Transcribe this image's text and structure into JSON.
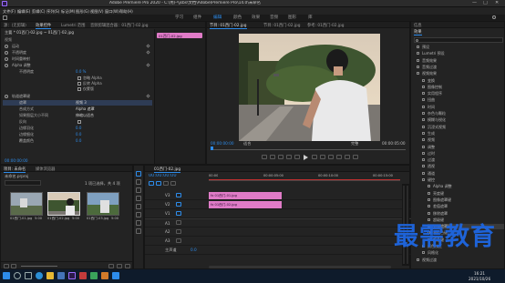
{
  "title_bar": {
    "text": "Adobe Premiere Pro 2020 - C:\\用户\\jsbs\\文档\\Adobe\\Premiere Pro\\14.0\\未命名",
    "minimize": "—",
    "maximize": "□",
    "close": "✕"
  },
  "menu": [
    "文件(F)",
    "编辑(E)",
    "剪辑(C)",
    "序列(S)",
    "标记(M)",
    "图形(G)",
    "视图(V)",
    "窗口(W)",
    "帮助(H)"
  ],
  "workspaces": [
    "学习",
    "组件",
    "编辑",
    "颜色",
    "效果",
    "音频",
    "图形",
    "库"
  ],
  "active_workspace": "编辑",
  "effect_controls": {
    "tabs": [
      "源：(无剪辑)",
      "效果控件",
      "Lumetri 范围",
      "音频剪辑混合器：01西门-02.jpg"
    ],
    "active_tab": "效果控件",
    "header": "主要 * 01西门-02.jpg ~ 01西门-02.jpg",
    "clip_bar": "01西门-02.jpg",
    "sections": [
      {
        "name": "视频",
        "rows": []
      },
      {
        "name": "运动",
        "rows": []
      },
      {
        "name": "不透明度",
        "rows": []
      },
      {
        "name": "时间重映射",
        "rows": []
      },
      {
        "name": "Alpha 调整",
        "rows": [
          {
            "label": "不透明度",
            "value": "0.0 %"
          },
          {
            "label": "忽略 Alpha",
            "value": ""
          },
          {
            "label": "反转 Alpha",
            "value": ""
          },
          {
            "label": "仅蒙版",
            "value": ""
          }
        ]
      },
      {
        "name": "轨道遮罩键",
        "rows": [
          {
            "label": "遮罩",
            "value": "视频 3"
          },
          {
            "label": "合成方式",
            "value": "Alpha 遮罩"
          },
          {
            "label": "如果图层大小不同",
            "value": "伸缩以适合"
          },
          {
            "label": "反向",
            "value": ""
          },
          {
            "label": "边缘羽化",
            "value": "0.0"
          },
          {
            "label": "边缘细化",
            "value": "0.0"
          },
          {
            "label": "覆盖颜色",
            "value": "0.0"
          }
        ]
      }
    ],
    "timecode": "00:00:00:00"
  },
  "program_monitor": {
    "title": "节目: 01西门-02.jpg",
    "tabs": [
      "节目: 01西门-02.jpg",
      "节目: 01西门-02.jpg",
      "参考: 01西门-02.jpg"
    ],
    "timecode_left": "00:00:00:00",
    "fit": "适合",
    "quality": "完整",
    "timecode_right": "00:00:05:00"
  },
  "project": {
    "tabs": [
      "项目: 未命名",
      "媒体浏览器"
    ],
    "name": "未命名.prproj",
    "count": "1 项已选择，共 4 项",
    "thumbs": [
      {
        "label": "01西门-01.jpg",
        "dur": "5:00"
      },
      {
        "label": "01西门-02.jpg",
        "dur": "5:00"
      },
      {
        "label": "01西门-03.jpg",
        "dur": "5:00"
      }
    ]
  },
  "timeline": {
    "title": "01西门-02.jpg",
    "timecode": "00:00:00:00",
    "tracks": [
      "V3",
      "V2",
      "V1",
      "A1",
      "A2",
      "A3",
      "主声道"
    ],
    "master_value": "0.0",
    "clips": [
      {
        "track": "V3",
        "label": "fx 01西门-01.jpg"
      },
      {
        "track": "V2",
        "label": "fx 01西门-02.jpg"
      }
    ],
    "ruler": [
      "00:00",
      "00:00:05:00",
      "00:00:10:00",
      "00:00:15:00"
    ]
  },
  "effects_panel": {
    "tabs": [
      "信息",
      "效果"
    ],
    "active": "效果",
    "search_placeholder": "",
    "tree": [
      "预设",
      "Lumetri 预设",
      "音频效果",
      "音频过渡",
      "视频效果",
      "变换",
      "图像控制",
      "实用程序",
      "扭曲",
      "时间",
      "杂色与颗粒",
      "模糊与锐化",
      "沉浸式视频",
      "生成",
      "视频",
      "调整",
      "过时",
      "过渡",
      "透视",
      "通道",
      "键控",
      "Alpha 调整",
      "亮度键",
      "图像遮罩键",
      "差值遮罩",
      "移除遮罩",
      "超级键",
      "轨道遮罩键",
      "非红色键",
      "颜色键",
      "颜色校正",
      "风格化",
      "视频过渡"
    ],
    "highlight": "轨道遮罩键"
  },
  "watermark": "最需教育",
  "taskbar": {
    "time": "16:21",
    "date": "2021/10/26"
  },
  "colors": {
    "accent": "#2d8ceb",
    "clip": "#e07bc7",
    "watermark": "#1e63d8"
  }
}
